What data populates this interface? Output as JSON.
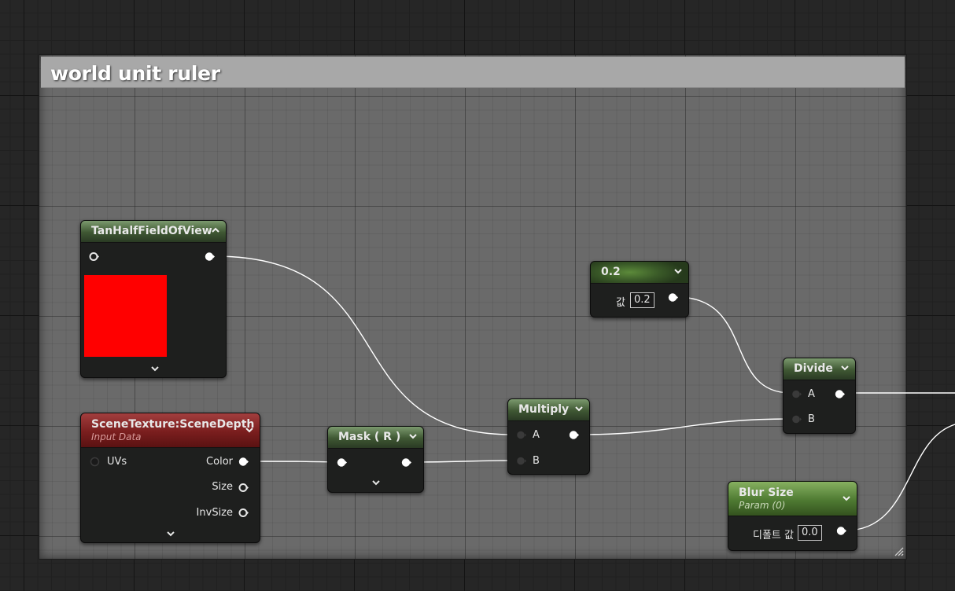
{
  "comment": {
    "title": "world unit ruler"
  },
  "nodes": {
    "tan": {
      "title": "TanHalfFieldOfView"
    },
    "scene": {
      "title": "SceneTexture:SceneDepth",
      "subtitle": "Input Data",
      "pins": {
        "uvs": "UVs",
        "color": "Color",
        "size": "Size",
        "invsize": "InvSize"
      }
    },
    "mask": {
      "title": "Mask ( R )"
    },
    "multiply": {
      "title": "Multiply",
      "pins": {
        "a": "A",
        "b": "B"
      }
    },
    "const": {
      "title": "0.2",
      "value_label": "값",
      "value": "0.2"
    },
    "divide": {
      "title": "Divide",
      "pins": {
        "a": "A",
        "b": "B"
      }
    },
    "blur": {
      "title": "Blur Size",
      "subtitle": "Param (0)",
      "default_label": "디폴트 값",
      "value": "0.0"
    }
  },
  "colors": {
    "preview_swatch": "#ff0000",
    "wire": "#ffffff",
    "scalar_header": "#3f5733",
    "scenetexture_header": "#7a1e1e"
  }
}
